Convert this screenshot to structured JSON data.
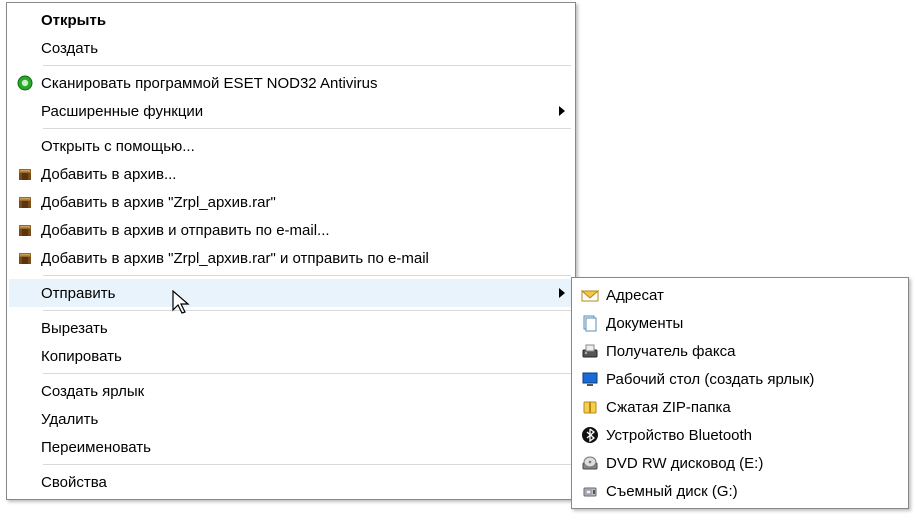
{
  "main_menu": {
    "groups": [
      [
        {
          "label": "Открыть",
          "bold": true,
          "icon": null,
          "submenu": false
        },
        {
          "label": "Создать",
          "icon": null,
          "submenu": false
        }
      ],
      [
        {
          "label": "Сканировать программой ESET NOD32 Antivirus",
          "icon": "eset-icon",
          "submenu": false
        },
        {
          "label": "Расширенные функции",
          "icon": null,
          "submenu": true
        }
      ],
      [
        {
          "label": "Открыть с помощью...",
          "icon": null,
          "submenu": false
        },
        {
          "label": "Добавить в архив...",
          "icon": "winrar-icon",
          "submenu": false
        },
        {
          "label": "Добавить в архив \"Zrpl_архив.rar\"",
          "icon": "winrar-icon",
          "submenu": false
        },
        {
          "label": "Добавить в архив и отправить по e-mail...",
          "icon": "winrar-icon",
          "submenu": false
        },
        {
          "label": "Добавить в архив \"Zrpl_архив.rar\" и отправить по e-mail",
          "icon": "winrar-icon",
          "submenu": false
        }
      ],
      [
        {
          "label": "Отправить",
          "icon": null,
          "submenu": true,
          "highlight": true
        }
      ],
      [
        {
          "label": "Вырезать",
          "icon": null,
          "submenu": false
        },
        {
          "label": "Копировать",
          "icon": null,
          "submenu": false
        }
      ],
      [
        {
          "label": "Создать ярлык",
          "icon": null,
          "submenu": false
        },
        {
          "label": "Удалить",
          "icon": null,
          "submenu": false
        },
        {
          "label": "Переименовать",
          "icon": null,
          "submenu": false
        }
      ],
      [
        {
          "label": "Свойства",
          "icon": null,
          "submenu": false
        }
      ]
    ]
  },
  "sub_menu": {
    "items": [
      {
        "label": "Адресат",
        "icon": "mail-icon"
      },
      {
        "label": "Документы",
        "icon": "documents-icon"
      },
      {
        "label": "Получатель факса",
        "icon": "fax-icon"
      },
      {
        "label": "Рабочий стол (создать ярлык)",
        "icon": "desktop-icon"
      },
      {
        "label": "Сжатая ZIP-папка",
        "icon": "zip-icon"
      },
      {
        "label": "Устройство Bluetooth",
        "icon": "bluetooth-icon"
      },
      {
        "label": "DVD RW дисковод (E:)",
        "icon": "dvd-icon"
      },
      {
        "label": "Съемный диск (G:)",
        "icon": "usb-icon"
      }
    ]
  }
}
